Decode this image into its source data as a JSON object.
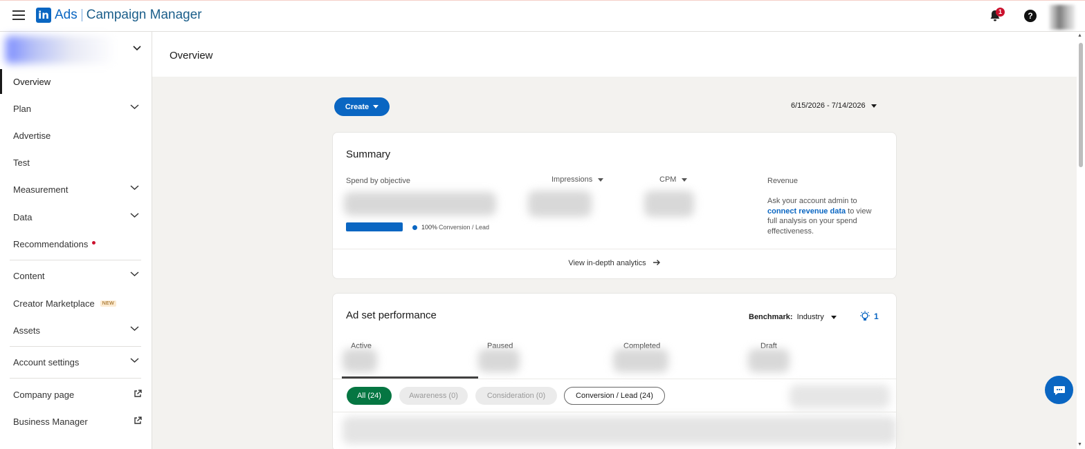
{
  "header": {
    "logo_in": "in",
    "logo_ads": "Ads",
    "logo_title": "Campaign Manager",
    "notification_count": "1",
    "help_label": "?"
  },
  "sidebar": {
    "items": [
      {
        "label": "Overview"
      },
      {
        "label": "Plan"
      },
      {
        "label": "Advertise"
      },
      {
        "label": "Test"
      },
      {
        "label": "Measurement"
      },
      {
        "label": "Data"
      },
      {
        "label": "Recommendations"
      },
      {
        "label": "Content"
      },
      {
        "label": "Creator Marketplace",
        "tag": "NEW"
      },
      {
        "label": "Assets"
      },
      {
        "label": "Account settings"
      },
      {
        "label": "Company page"
      },
      {
        "label": "Business Manager"
      }
    ]
  },
  "main": {
    "title": "Overview",
    "create_label": "Create",
    "date_range": "6/15/2026 - 7/14/2026"
  },
  "summary": {
    "title": "Summary",
    "spend_label": "Spend by objective",
    "impressions_label": "Impressions",
    "cpm_label": "CPM",
    "revenue_label": "Revenue",
    "legend_pct": "100%",
    "legend_label": "Conversion / Lead",
    "revenue_text_pre": "Ask your account admin to ",
    "revenue_link": "connect revenue data",
    "revenue_text_post": " to view full analysis on your spend effectiveness.",
    "view_analytics": "View in-depth analytics"
  },
  "adset": {
    "title": "Ad set performance",
    "benchmark_label": "Benchmark:",
    "benchmark_value": "Industry",
    "insights_count": "1",
    "tabs": [
      "Active",
      "Paused",
      "Completed",
      "Draft"
    ],
    "chips": [
      "All (24)",
      "Awareness (0)",
      "Consideration (0)",
      "Conversion / Lead (24)"
    ]
  },
  "colors": {
    "brand": "#0a66c2",
    "active_chip": "#057642",
    "notification": "#cb112d"
  }
}
